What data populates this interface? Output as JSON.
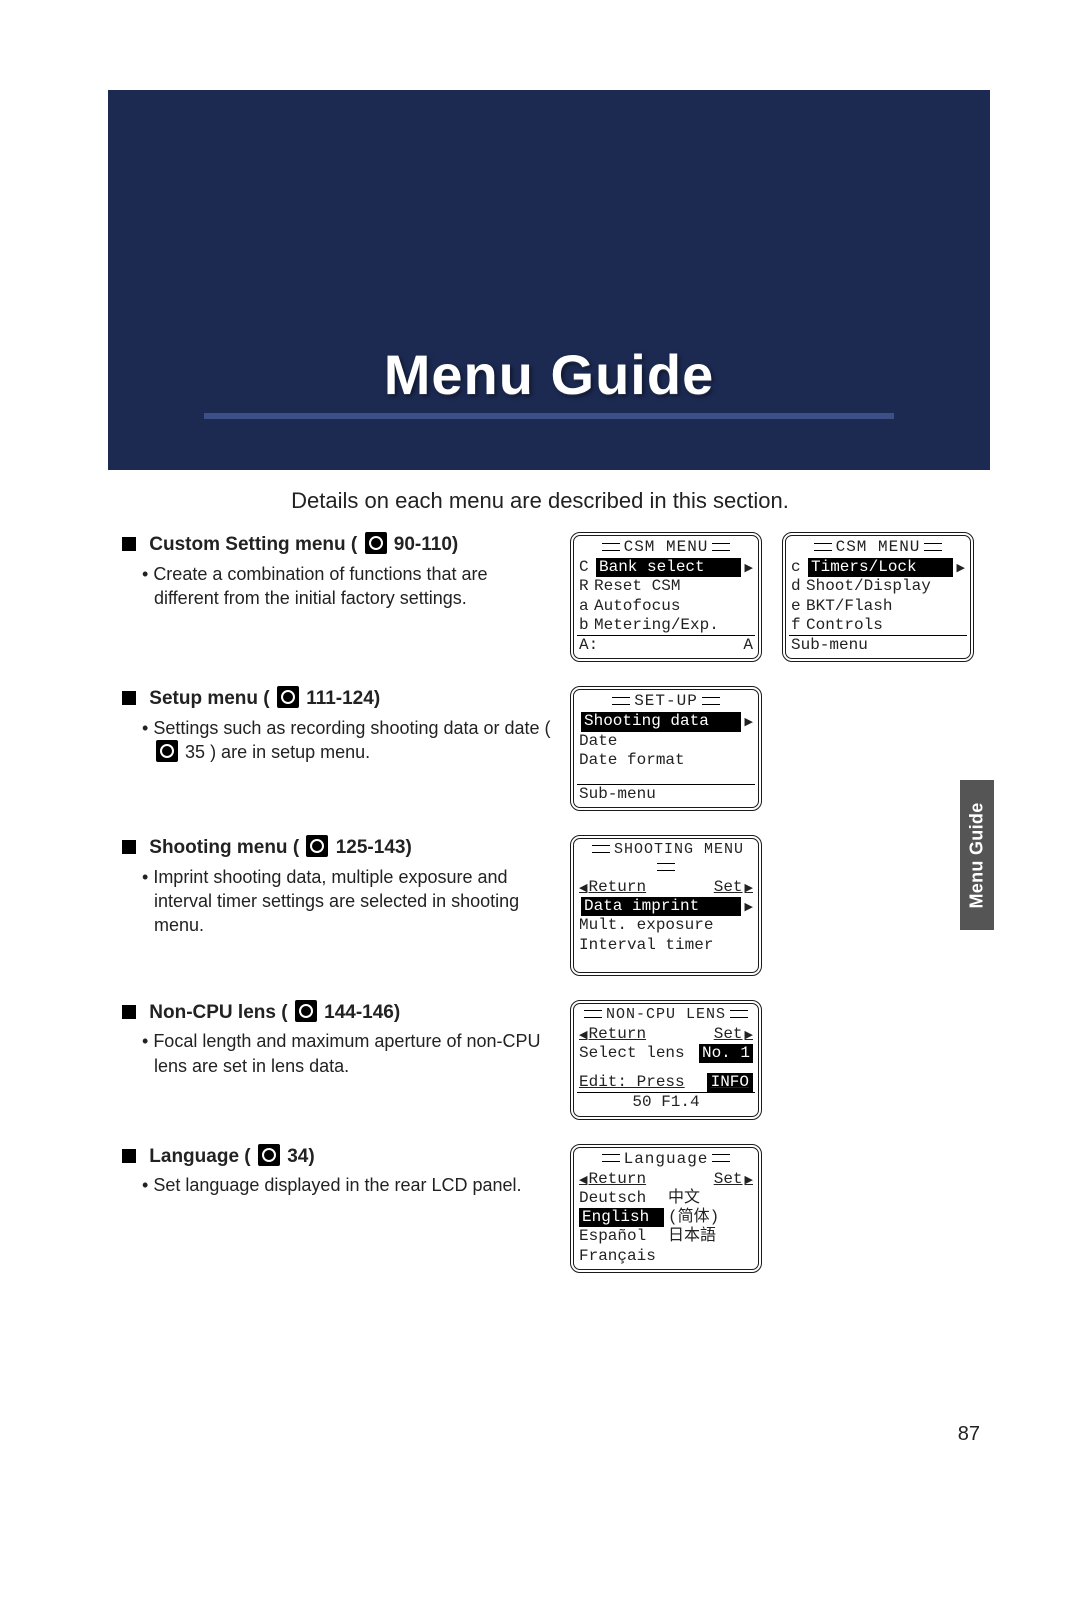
{
  "hero": {
    "title": "Menu Guide"
  },
  "subtitle": "Details on each menu are described in this section.",
  "sideTab": "Menu Guide",
  "pageNumber": "87",
  "sections": {
    "custom": {
      "heading_prefix": "Custom Setting menu (",
      "page_ref": " 90-110)",
      "desc": "Create a combination of functions that are different from the initial factory settings."
    },
    "setup": {
      "heading_prefix": "Setup menu (",
      "page_ref": " 111-124)",
      "desc_1": "Settings such as recording shooting data or date (",
      "desc_mid_ref": " 35",
      "desc_2": ") are in setup menu."
    },
    "shooting": {
      "heading_prefix": "Shooting menu (",
      "page_ref": " 125-143)",
      "desc": "Imprint shooting data, multiple exposure and interval timer settings are selected in shooting menu."
    },
    "noncpu": {
      "heading_prefix": "Non-CPU lens (",
      "page_ref": " 144-146)",
      "desc": "Focal length and maximum aperture of non-CPU lens are set in lens data."
    },
    "language": {
      "heading_prefix": "Language (",
      "page_ref": " 34)",
      "desc": "Set language displayed in the rear LCD panel."
    }
  },
  "screens": {
    "csm1": {
      "title": "CSM MENU",
      "rows": {
        "r1": {
          "lead": "C",
          "label": "Bank select"
        },
        "r2": {
          "lead": "R",
          "label": "Reset CSM"
        },
        "r3": {
          "lead": "a",
          "label": "Autofocus"
        },
        "r4": {
          "lead": "b",
          "label": "Metering/Exp."
        }
      },
      "footer": {
        "left": "A:",
        "right": "A"
      }
    },
    "csm2": {
      "title": "CSM MENU",
      "rows": {
        "r1": {
          "lead": "c",
          "label": "Timers/Lock"
        },
        "r2": {
          "lead": "d",
          "label": "Shoot/Display"
        },
        "r3": {
          "lead": "e",
          "label": "BKT/Flash"
        },
        "r4": {
          "lead": "f",
          "label": "Controls"
        }
      },
      "footer": "Sub-menu"
    },
    "setup": {
      "title": "SET-UP",
      "rows": {
        "r1": "Shooting data",
        "r2": "Date",
        "r3": "Date format"
      },
      "footer": "Sub-menu"
    },
    "shooting": {
      "title": "SHOOTING MENU",
      "return": "Return",
      "set": "Set",
      "rows": {
        "r1": "Data imprint",
        "r2": "Mult. exposure",
        "r3": "Interval timer"
      }
    },
    "noncpu": {
      "title": "NON-CPU LENS",
      "return": "Return",
      "set": "Set",
      "rows": {
        "r1": "Select lens",
        "no_label": "No.",
        "no_val": "1"
      },
      "edit_label": "Edit: Press",
      "edit_badge": "INFO",
      "footer": "50 F1.4"
    },
    "language": {
      "title": "Language",
      "return": "Return",
      "set": "Set",
      "left": {
        "l1": "Deutsch",
        "l2": "English",
        "l3": "Español",
        "l4": "Français"
      },
      "right": {
        "r1": "中文",
        "r2": "(简体)",
        "r3": "日本語"
      }
    }
  }
}
